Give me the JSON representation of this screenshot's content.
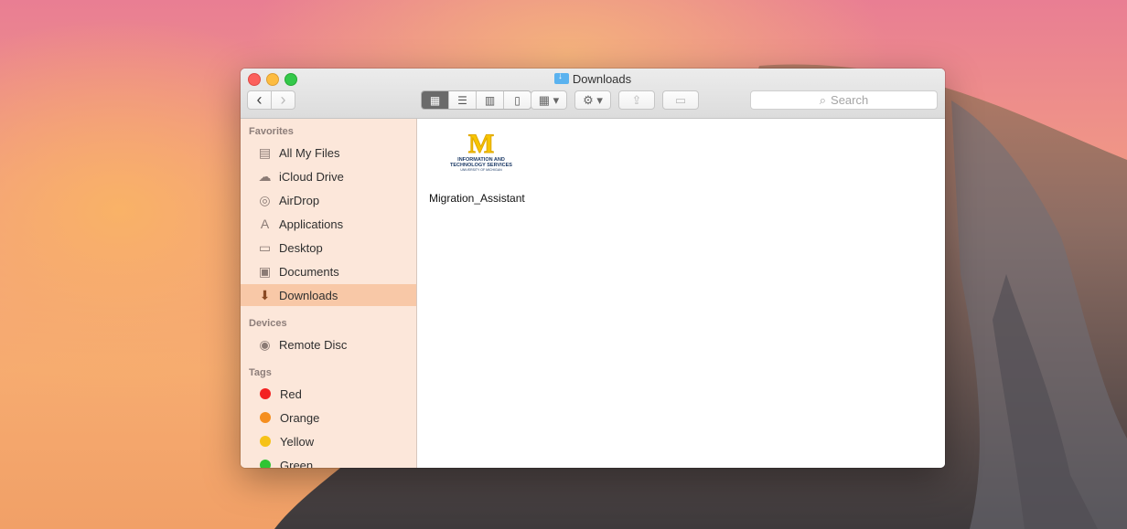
{
  "window": {
    "title": "Downloads"
  },
  "toolbar": {
    "back": "‹",
    "forward": "›",
    "views": [
      "icon-view",
      "list-view",
      "column-view",
      "coverflow-view"
    ],
    "search_placeholder": "Search"
  },
  "sidebar": {
    "sections": {
      "favorites": "Favorites",
      "devices": "Devices",
      "tags": "Tags"
    },
    "favorites": [
      {
        "label": "All My Files",
        "icon": "all-files-icon"
      },
      {
        "label": "iCloud Drive",
        "icon": "cloud-icon"
      },
      {
        "label": "AirDrop",
        "icon": "airdrop-icon"
      },
      {
        "label": "Applications",
        "icon": "applications-icon"
      },
      {
        "label": "Desktop",
        "icon": "desktop-icon"
      },
      {
        "label": "Documents",
        "icon": "documents-icon"
      },
      {
        "label": "Downloads",
        "icon": "downloads-icon",
        "selected": true
      }
    ],
    "devices": [
      {
        "label": "Remote Disc",
        "icon": "disc-icon"
      }
    ],
    "tags": [
      {
        "label": "Red",
        "color": "#f32121"
      },
      {
        "label": "Orange",
        "color": "#f58e1e"
      },
      {
        "label": "Yellow",
        "color": "#f6c217"
      },
      {
        "label": "Green",
        "color": "#2ec533"
      }
    ]
  },
  "content": {
    "files": [
      {
        "name": "Migration_Assistant",
        "logo_letter": "M",
        "logo_line1": "INFORMATION AND",
        "logo_line2": "TECHNOLOGY SERVICES",
        "logo_line3": "UNIVERSITY OF MICHIGAN"
      }
    ]
  }
}
